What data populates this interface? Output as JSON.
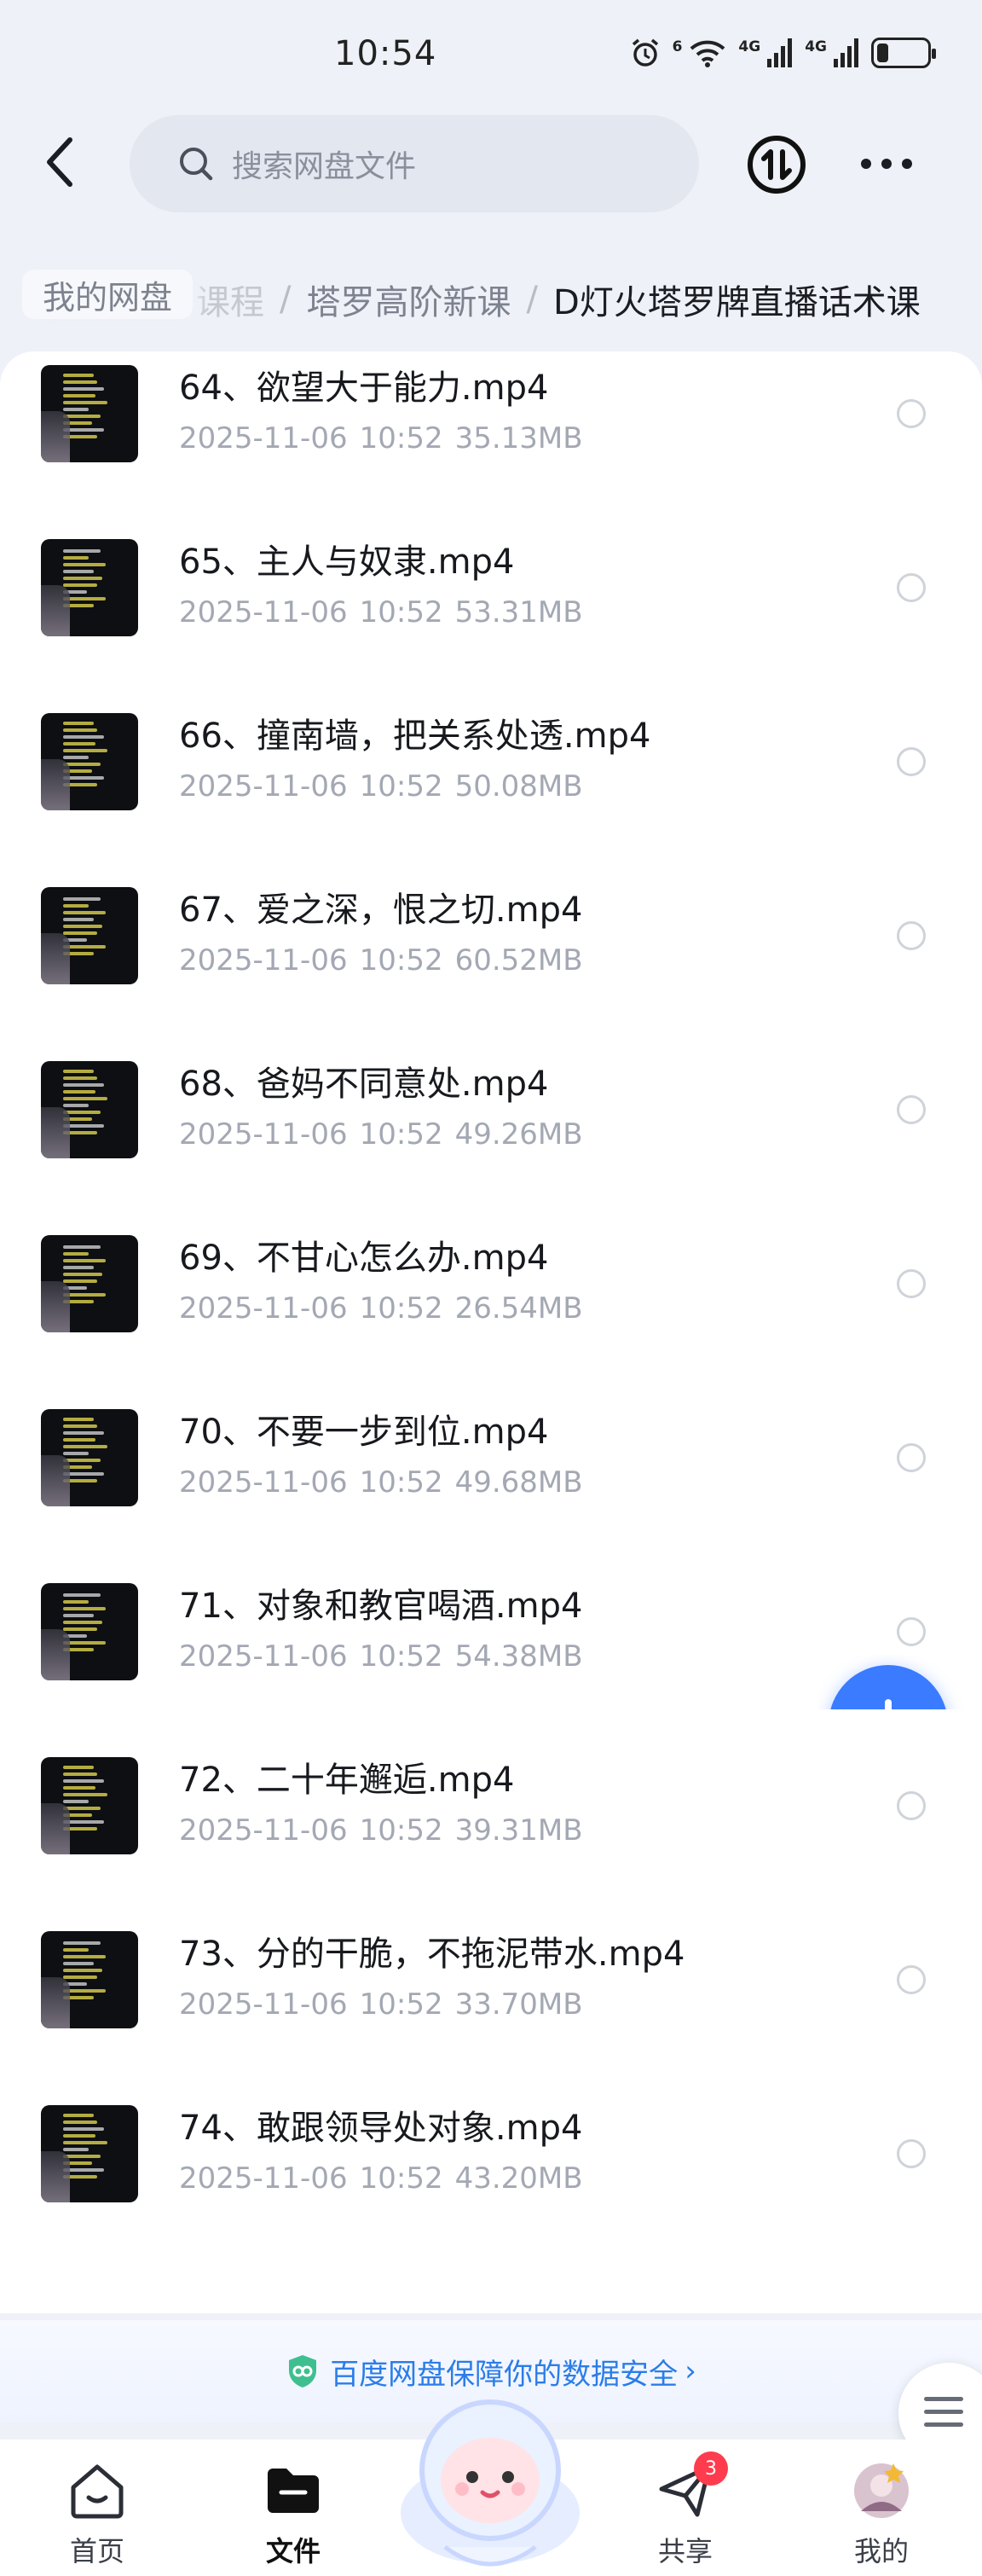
{
  "status_bar": {
    "time": "10:54",
    "wifi_label": "6",
    "signal1_label": "4G",
    "signal2_label": "4G",
    "battery_level": 0.22,
    "icons": [
      "alarm-icon",
      "wifi-icon",
      "signal-icon",
      "signal-icon",
      "battery-icon"
    ]
  },
  "header": {
    "search_placeholder": "搜索网盘文件",
    "icons": [
      "back-icon",
      "search-icon",
      "transfer-icon",
      "more-icon"
    ]
  },
  "breadcrumb": {
    "root": "我的网盘",
    "faded": "课程",
    "items": [
      "塔罗高阶新课",
      "D灯火塔罗牌直播话术课"
    ],
    "separator": "/"
  },
  "files": [
    {
      "name": "64、欲望大于能力.mp4",
      "date": "2025-11-06",
      "time": "10:52",
      "size": "35.13MB"
    },
    {
      "name": "65、主人与奴隶.mp4",
      "date": "2025-11-06",
      "time": "10:52",
      "size": "53.31MB"
    },
    {
      "name": "66、撞南墙，把关系处透.mp4",
      "date": "2025-11-06",
      "time": "10:52",
      "size": "50.08MB"
    },
    {
      "name": "67、爱之深，恨之切.mp4",
      "date": "2025-11-06",
      "time": "10:52",
      "size": "60.52MB"
    },
    {
      "name": "68、爸妈不同意处.mp4",
      "date": "2025-11-06",
      "time": "10:52",
      "size": "49.26MB"
    },
    {
      "name": "69、不甘心怎么办.mp4",
      "date": "2025-11-06",
      "time": "10:52",
      "size": "26.54MB"
    },
    {
      "name": "70、不要一步到位.mp4",
      "date": "2025-11-06",
      "time": "10:52",
      "size": "49.68MB"
    },
    {
      "name": "71、对象和教官喝酒.mp4",
      "date": "2025-11-06",
      "time": "10:52",
      "size": "54.38MB"
    },
    {
      "name": "72、二十年邂逅.mp4",
      "date": "2025-11-06",
      "time": "10:52",
      "size": "39.31MB"
    },
    {
      "name": "73、分的干脆，不拖泥带水.mp4",
      "date": "2025-11-06",
      "time": "10:52",
      "size": "33.70MB"
    },
    {
      "name": "74、敢跟领导处对象.mp4",
      "date": "2025-11-06",
      "time": "10:52",
      "size": "43.20MB"
    }
  ],
  "security_banner": {
    "text": "百度网盘保障你的数据安全",
    "icon": "shield-icon",
    "color": "#2b7de9"
  },
  "bottom_nav": {
    "items": [
      {
        "label": "首页",
        "icon": "home-icon",
        "active": false
      },
      {
        "label": "文件",
        "icon": "folder-icon",
        "active": true
      },
      {
        "label": "共享",
        "icon": "send-icon",
        "active": false,
        "badge": "3"
      },
      {
        "label": "我的",
        "icon": "avatar-icon",
        "active": false
      }
    ]
  },
  "colors": {
    "accent": "#3a7bff",
    "background": "#eef1f7",
    "badge": "#ff3b4e"
  }
}
